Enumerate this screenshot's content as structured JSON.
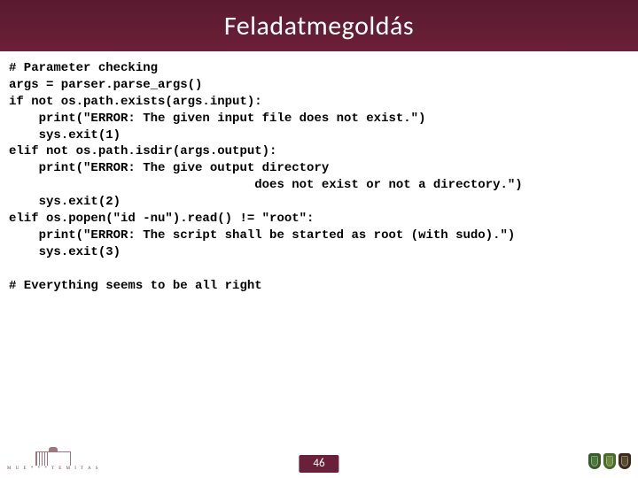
{
  "title": "Feladatmegoldás",
  "code_lines": [
    "# Parameter checking",
    "args = parser.parse_args()",
    "if not os.path.exists(args.input):",
    "    print(\"ERROR: The given input file does not exist.\")",
    "    sys.exit(1)",
    "elif not os.path.isdir(args.output):",
    "    print(\"ERROR: The give output directory",
    "                                 does not exist or not a directory.\")",
    "    sys.exit(2)",
    "elif os.popen(\"id -nu\").read() != \"root\":",
    "    print(\"ERROR: The script shall be started as root (with sudo).\")",
    "    sys.exit(3)",
    "",
    "# Everything seems to be all right"
  ],
  "page_number": "46",
  "footer_logo_text": "M U E * * * T E M   I T A S"
}
